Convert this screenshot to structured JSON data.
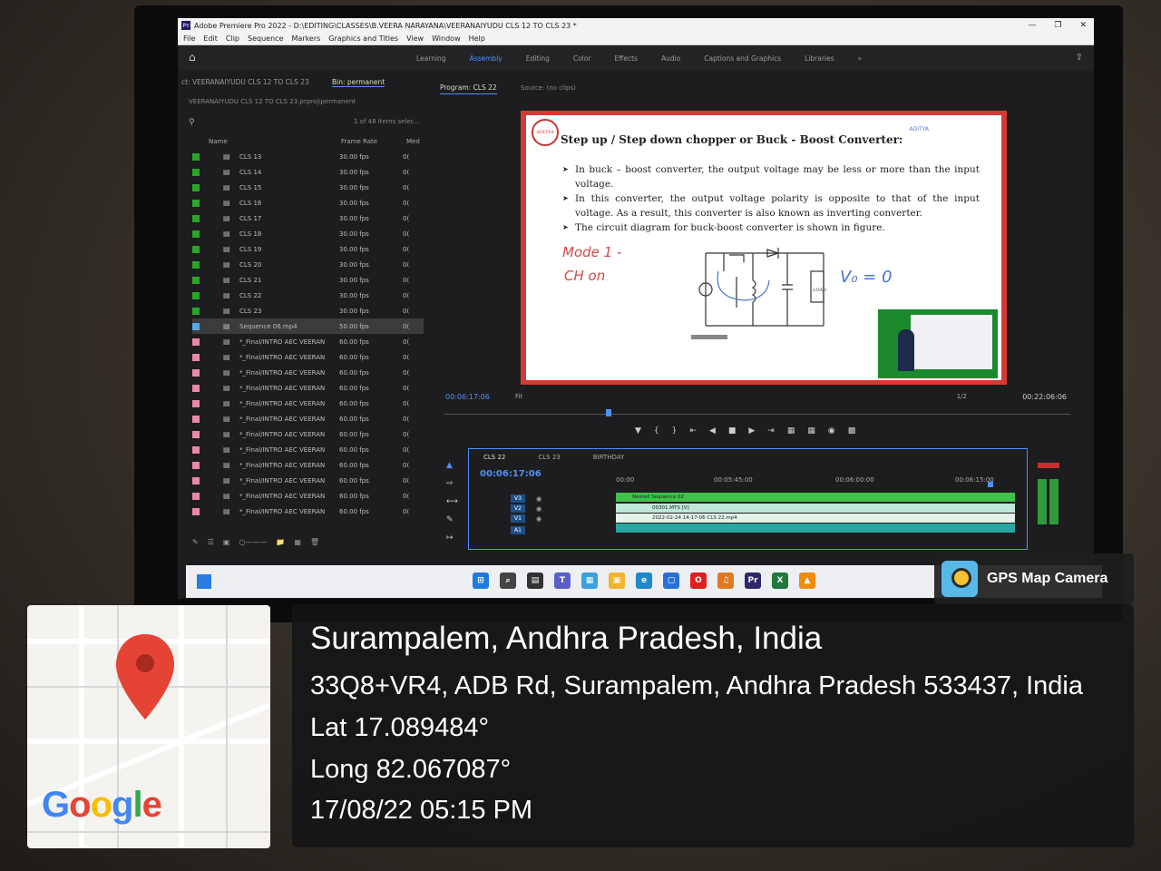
{
  "window": {
    "title": "Adobe Premiere Pro 2022 - D:\\EDITING\\CLASSES\\B.VEERA NARAYANA\\VEERANAIYUDU CLS 12 TO CLS 23 *",
    "minimize": "—",
    "maximize": "❐",
    "close": "✕"
  },
  "menu": [
    "File",
    "Edit",
    "Clip",
    "Sequence",
    "Markers",
    "Graphics and Titles",
    "View",
    "Window",
    "Help"
  ],
  "workspaces": {
    "tabs": [
      "Learning",
      "Assembly",
      "Editing",
      "Color",
      "Effects",
      "Audio",
      "Captions and Graphics",
      "Libraries"
    ],
    "active": "Assembly",
    "more": "»"
  },
  "project": {
    "tab_left": "ct: VEERANAIYUDU CLS 12 TO CLS 23",
    "bin_tab": "Bin: permanent",
    "path": "VEERANAIYUDU CLS 12 TO CLS 23.prproj\\permanent",
    "item_count": "1 of 48 items selec...",
    "columns": {
      "name": "Name",
      "frame_rate": "Frame Rate",
      "media": "Med"
    },
    "rows": [
      {
        "name": "CLS 13",
        "fps": "30.00 fps",
        "color": "#2aa52a"
      },
      {
        "name": "CLS 14",
        "fps": "30.00 fps",
        "color": "#2aa52a"
      },
      {
        "name": "CLS 15",
        "fps": "30.00 fps",
        "color": "#2aa52a"
      },
      {
        "name": "CLS 16",
        "fps": "30.00 fps",
        "color": "#2aa52a"
      },
      {
        "name": "CLS 17",
        "fps": "30.00 fps",
        "color": "#2aa52a"
      },
      {
        "name": "CLS 18",
        "fps": "30.00 fps",
        "color": "#2aa52a"
      },
      {
        "name": "CLS 19",
        "fps": "30.00 fps",
        "color": "#2aa52a"
      },
      {
        "name": "CLS 20",
        "fps": "30.00 fps",
        "color": "#2aa52a"
      },
      {
        "name": "CLS 21",
        "fps": "30.00 fps",
        "color": "#2aa52a"
      },
      {
        "name": "CLS 22",
        "fps": "30.00 fps",
        "color": "#2aa52a"
      },
      {
        "name": "CLS 23",
        "fps": "30.00 fps",
        "color": "#2aa52a"
      },
      {
        "name": "Sequence 06.mp4",
        "fps": "50.00 fps",
        "color": "#5aa6e0",
        "selected": true
      },
      {
        "name": "*_Final/INTRO AEC VEERAN",
        "fps": "60.00 fps",
        "color": "#e88aa6"
      },
      {
        "name": "*_Final/INTRO AEC VEERAN",
        "fps": "60.00 fps",
        "color": "#e88aa6"
      },
      {
        "name": "*_Final/INTRO AEC VEERAN",
        "fps": "60.00 fps",
        "color": "#e88aa6"
      },
      {
        "name": "*_Final/INTRO AEC VEERAN",
        "fps": "60.00 fps",
        "color": "#e88aa6"
      },
      {
        "name": "*_Final/INTRO AEC VEERAN",
        "fps": "60.00 fps",
        "color": "#e88aa6"
      },
      {
        "name": "*_Final/INTRO AEC VEERAN",
        "fps": "60.00 fps",
        "color": "#e88aa6"
      },
      {
        "name": "*_Final/INTRO AEC VEERAN",
        "fps": "60.00 fps",
        "color": "#e88aa6"
      },
      {
        "name": "*_Final/INTRO AEC VEERAN",
        "fps": "60.00 fps",
        "color": "#e88aa6"
      },
      {
        "name": "*_Final/INTRO AEC VEERAN",
        "fps": "60.00 fps",
        "color": "#e88aa6"
      },
      {
        "name": "*_Final/INTRO AEC VEERAN",
        "fps": "60.00 fps",
        "color": "#e88aa6"
      },
      {
        "name": "*_Final/INTRO AEC VEERAN",
        "fps": "60.00 fps",
        "color": "#e88aa6"
      },
      {
        "name": "*_Final/INTRO AEC VEERAN",
        "fps": "60.00 fps",
        "color": "#e88aa6"
      }
    ],
    "media_cell": "0("
  },
  "program": {
    "tab": "Program: CLS 22",
    "source_tab": "Source: (no clips)",
    "timecode": "00:06:17:06",
    "fit": "Fit",
    "resolution": "1/2",
    "duration": "00:22:06:06"
  },
  "slide": {
    "title": "Step up / Step down chopper or Buck - Boost Converter:",
    "brand": "ADITYA",
    "logo": "ADITYA",
    "bullets": [
      "In buck – boost converter, the output voltage may be less or more than the input voltage.",
      "In this converter, the output voltage polarity is opposite to that of the input voltage. As a result, this converter is also known as inverting converter.",
      "The circuit diagram for buck-boost converter is shown in figure."
    ],
    "handwriting_1": "Mode 1 -",
    "handwriting_2": "CH on",
    "handwriting_3": "V₀ = 0",
    "load_label": "LOAD"
  },
  "timeline": {
    "tabs": [
      "CLS 22",
      "CLS 23",
      "BIRTHDAY"
    ],
    "active_tab": "CLS 22",
    "timecode": "00:06:17:06",
    "ruler": [
      "00:00",
      "00:05:45:00",
      "00:06:00:00",
      "00:06:15:00"
    ],
    "tracks": [
      "V3",
      "V2",
      "V1",
      "A1"
    ],
    "clips": [
      "Nested Sequence 02",
      "00301.MTS [V]",
      "2022-02-24 14-17-06 CLS 22.mp4"
    ]
  },
  "taskbar": {
    "icons": [
      "windows",
      "search",
      "task-view",
      "teams",
      "widgets",
      "explorer",
      "edge",
      "store",
      "opera",
      "media",
      "premiere",
      "excel",
      "vlc"
    ]
  },
  "gps": {
    "app": "GPS Map Camera",
    "place": "Surampalem, Andhra Pradesh, India",
    "address": "33Q8+VR4, ADB Rd, Surampalem, Andhra Pradesh 533437, India",
    "lat": "Lat 17.089484°",
    "long": "Long 82.067087°",
    "datetime": "17/08/22 05:15 PM",
    "map_brand": "Google"
  },
  "colors": {
    "accent": "#4f8ff7",
    "slide_border": "#d63a34",
    "clip_green": "#3fc24a",
    "clip_teal": "#2aa6a0"
  }
}
